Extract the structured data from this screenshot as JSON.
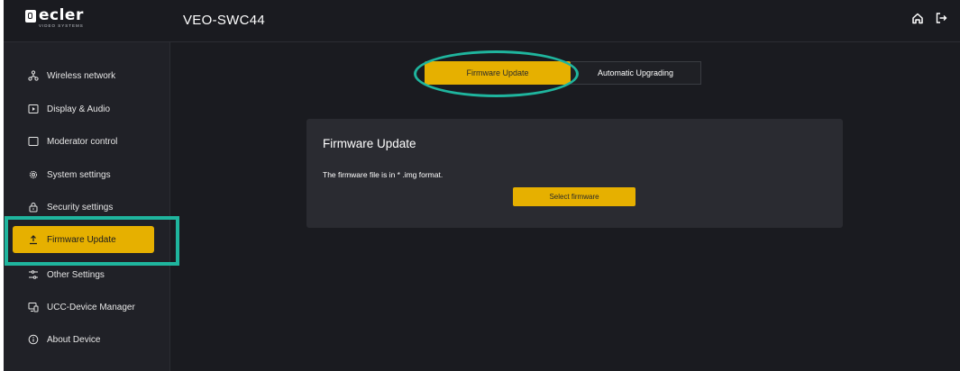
{
  "brand": {
    "name": "ecler",
    "tagline": "VIDEO SYSTEMS"
  },
  "header": {
    "title": "VEO-SWC44",
    "icons": [
      "home-icon",
      "logout-icon"
    ]
  },
  "sidebar": {
    "items": [
      {
        "label": "Wireless network",
        "icon": "network-icon"
      },
      {
        "label": "Display & Audio",
        "icon": "play-screen-icon"
      },
      {
        "label": "Moderator control",
        "icon": "square-icon"
      },
      {
        "label": "System settings",
        "icon": "gear-icon"
      },
      {
        "label": "Security settings",
        "icon": "lock-icon"
      },
      {
        "label": "Firmware Update",
        "icon": "upload-icon",
        "active": true
      },
      {
        "label": "Other Settings",
        "icon": "sliders-icon"
      },
      {
        "label": "UCC-Device Manager",
        "icon": "device-icon"
      },
      {
        "label": "About Device",
        "icon": "info-icon"
      }
    ]
  },
  "tabs": [
    {
      "label": "Firmware Update",
      "active": true
    },
    {
      "label": "Automatic Upgrading",
      "active": false
    }
  ],
  "panel": {
    "title": "Firmware Update",
    "description": "The firmware file is in * .img format.",
    "button_label": "Select firmware"
  },
  "colors": {
    "accent": "#e6b000",
    "annotation": "#1fb59e",
    "background": "#1a1b20",
    "panel": "#2a2b31"
  }
}
